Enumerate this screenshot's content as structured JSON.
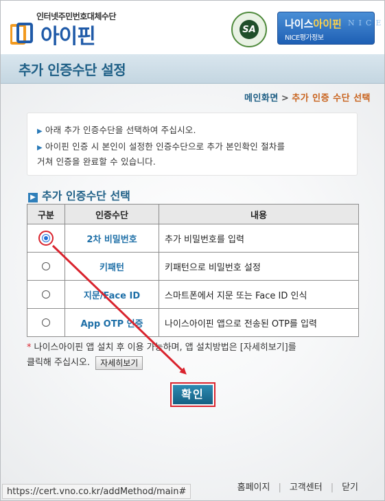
{
  "header": {
    "logo_subtitle": "인터넷주민번호대체수단",
    "logo_text": "아이핀",
    "sa_badge": "SA",
    "nice_title_part1": "나이스",
    "nice_title_part2": "아이핀",
    "nice_subtitle": "NICE평가정보",
    "nice_deco": "NICE"
  },
  "page_title": "추가 인증수단 설정",
  "breadcrumb": {
    "home": "메인화면",
    "separator": ">",
    "current": "추가 인증 수단 선택"
  },
  "notice": {
    "bullet": "▶",
    "line1": "아래 추가 인증수단을 선택하여 주십시오.",
    "line2": "아이핀 인증 시 본인이 설정한 인증수단으로 추가 본인확인 절차를",
    "line3": "거쳐 인증을 완료할 수 있습니다."
  },
  "section_title": "추가 인증수단 선택",
  "table": {
    "headers": [
      "구분",
      "인증수단",
      "내용"
    ],
    "rows": [
      {
        "name": "2차 비밀번호",
        "desc": "추가 비밀번호를 입력",
        "checked": true
      },
      {
        "name": "키패턴",
        "desc": "키패턴으로 비밀번호 설정",
        "checked": false
      },
      {
        "name": "지문/Face ID",
        "desc": "스마트폰에서 지문 또는 Face ID 인식",
        "checked": false
      },
      {
        "name": "App OTP 인증",
        "desc": "나이스아이핀 앱으로 전송된 OTP를 입력",
        "checked": false
      }
    ]
  },
  "install_note": {
    "star": "*",
    "text1": "나이스아이핀 앱 설치 후 이용 가능하며, 앱 설치방법은 [자세히보기]를",
    "text2": "클릭해 주십시오.",
    "detail_button": "자세히보기"
  },
  "confirm_button": "확인",
  "footer": {
    "links": [
      "홈페이지",
      "고객센터",
      "닫기"
    ]
  },
  "status_url": "https://cert.vno.co.kr/addMethod/main#",
  "colors": {
    "accent": "#1e5f86",
    "highlight": "#d9232d",
    "breadcrumb_current": "#c8621c"
  }
}
